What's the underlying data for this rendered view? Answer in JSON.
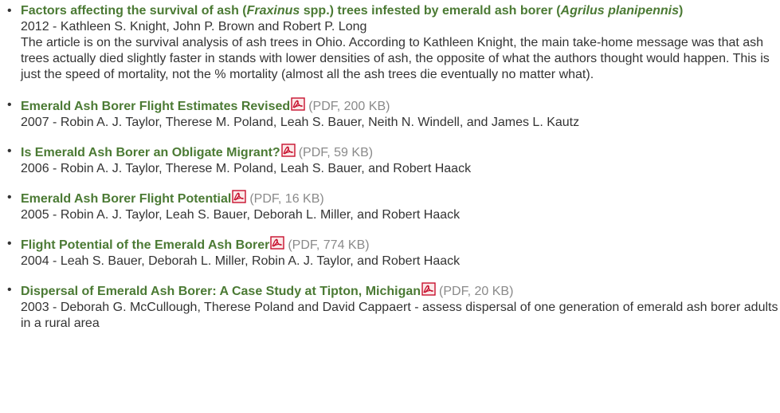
{
  "publications": [
    {
      "title_pre": "Factors affecting the survival of ash (",
      "title_em1": "Fraxinus",
      "title_mid": " spp.) trees infested by emerald ash borer (",
      "title_em2": "Agrilus planipennis",
      "title_post": ")",
      "byline": "2012 - Kathleen S. Knight, John P. Brown and Robert P. Long",
      "description": "The article is on the survival analysis of ash trees in Ohio. According to Kathleen Knight, the main take-home message was that ash trees actually died slightly faster in stands with lower densities of ash, the opposite of what the authors thought would happen. This is just the speed of mortality, not the % mortality (almost all the ash trees die eventually no matter what)."
    },
    {
      "title": "Emerald Ash Borer Flight Estimates Revised",
      "pdf": "(PDF, 200 KB)",
      "byline": "2007 - Robin A. J. Taylor, Therese M. Poland, Leah S. Bauer, Neith N. Windell, and James L. Kautz"
    },
    {
      "title": "Is Emerald Ash Borer an Obligate Migrant?",
      "pdf": "(PDF, 59 KB)",
      "byline": "2006 - Robin A. J. Taylor, Therese M. Poland, Leah S. Bauer, and Robert Haack"
    },
    {
      "title": "Emerald Ash Borer Flight Potential",
      "pdf": "(PDF, 16 KB)",
      "byline": "2005 - Robin A. J. Taylor, Leah S. Bauer, Deborah L. Miller, and Robert Haack"
    },
    {
      "title": "Flight Potential of the Emerald Ash Borer",
      "pdf": "(PDF, 774 KB)",
      "byline": "2004 - Leah S. Bauer, Deborah L. Miller, Robin A. J. Taylor, and Robert Haack"
    },
    {
      "title": "Dispersal of Emerald Ash Borer: A Case Study at Tipton, Michigan",
      "pdf": "(PDF, 20 KB)",
      "byline": "2003 - Deborah G. McCullough, Therese Poland and David Cappaert - assess dispersal of one generation of emerald ash borer adults in a rural area"
    }
  ],
  "bullet_char": "•",
  "icons": {
    "pdf": "pdf-icon"
  },
  "colors": {
    "link": "#4b7a34",
    "text": "#333333",
    "meta": "#8a8a8a",
    "pdf_icon": "#c8102e"
  }
}
